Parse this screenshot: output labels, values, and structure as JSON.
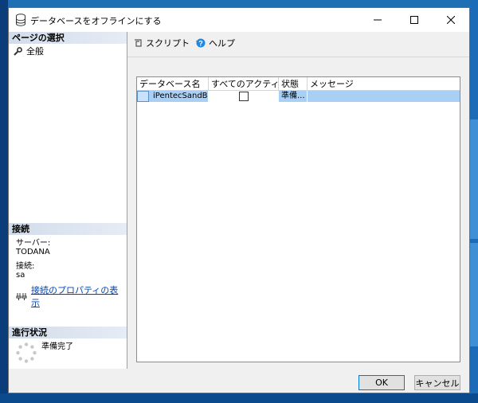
{
  "window": {
    "title": "データベースをオフラインにする"
  },
  "sidebar": {
    "page_select_header": "ページの選択",
    "items": [
      {
        "label": "全般",
        "icon": "wrench-icon"
      }
    ],
    "connection_header": "接続",
    "server_label": "サーバー:",
    "server_value": "TODANA",
    "connection_label": "接続:",
    "connection_value": "sa",
    "properties_link": "接続のプロパティの表示",
    "progress_header": "進行状況",
    "progress_status": "準備完了"
  },
  "toolbar": {
    "script_label": "スクリプト",
    "help_label": "ヘルプ"
  },
  "grid": {
    "columns": [
      "データベース名",
      "すべてのアクティブ...",
      "状態",
      "メッセージ"
    ],
    "rows": [
      {
        "database": "iPentecSandB...",
        "drop_all": false,
        "status": "準備...",
        "message": ""
      }
    ]
  },
  "buttons": {
    "ok": "OK",
    "cancel": "キャンセル"
  }
}
